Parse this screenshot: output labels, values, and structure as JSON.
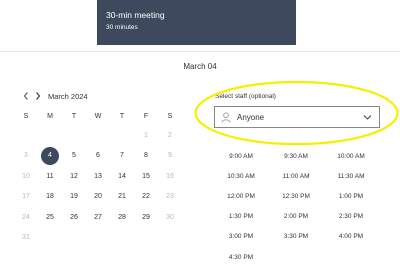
{
  "service": {
    "title": "30-min meeting",
    "duration": "30 minutes",
    "globe_icon": "globe-icon",
    "info_icon": "i",
    "card_color": "#3d4a5e"
  },
  "selected_date_heading": "March 04",
  "calendar": {
    "month_label": "March 2024",
    "weekdays": [
      "S",
      "M",
      "T",
      "W",
      "T",
      "F",
      "S"
    ],
    "weeks": [
      [
        null,
        null,
        null,
        null,
        null,
        "1",
        "2"
      ],
      [
        "3",
        "4",
        "5",
        "6",
        "7",
        "8",
        "9"
      ],
      [
        "10",
        "11",
        "12",
        "13",
        "14",
        "15",
        "16"
      ],
      [
        "17",
        "18",
        "19",
        "20",
        "21",
        "22",
        "23"
      ],
      [
        "24",
        "25",
        "26",
        "27",
        "28",
        "29",
        "30"
      ],
      [
        "31",
        null,
        null,
        null,
        null,
        null,
        null
      ]
    ],
    "selected_day": "4",
    "accent_color": "#3d4a5e"
  },
  "staff": {
    "label": "Select staff (optional)",
    "value": "Anyone",
    "highlight_color": "#f5f000"
  },
  "time_slots": [
    [
      "9:00 AM",
      "9:30 AM",
      "10:00 AM"
    ],
    [
      "10:30 AM",
      "11:00 AM",
      "11:30 AM"
    ],
    [
      "12:00 PM",
      "12:30 PM",
      "1:00 PM"
    ],
    [
      "1:30 PM",
      "2:00 PM",
      "2:30 PM"
    ],
    [
      "3:00 PM",
      "3:30 PM",
      "4:00 PM"
    ],
    [
      "4:30 PM",
      null,
      null
    ]
  ]
}
